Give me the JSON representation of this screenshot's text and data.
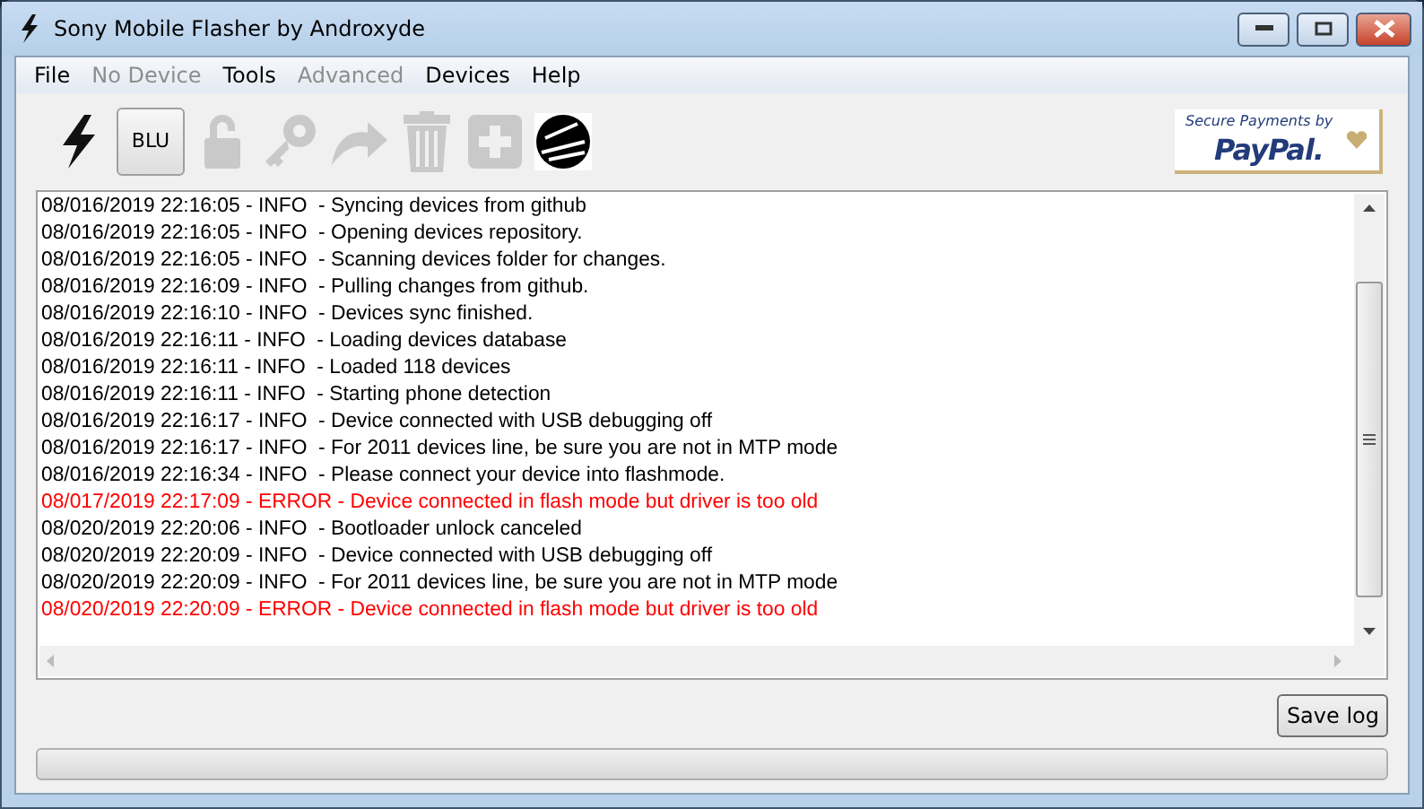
{
  "window": {
    "title": "Sony Mobile Flasher by Androxyde"
  },
  "menu": [
    {
      "label": "File",
      "disabled": false
    },
    {
      "label": "No Device",
      "disabled": true
    },
    {
      "label": "Tools",
      "disabled": false
    },
    {
      "label": "Advanced",
      "disabled": true
    },
    {
      "label": "Devices",
      "disabled": false
    },
    {
      "label": "Help",
      "disabled": false
    }
  ],
  "toolbar": [
    {
      "kind": "flash",
      "disabled": false
    },
    {
      "kind": "text",
      "label": "BLU",
      "disabled": false
    },
    {
      "kind": "unlock",
      "disabled": true
    },
    {
      "kind": "key",
      "disabled": true
    },
    {
      "kind": "redo",
      "disabled": true
    },
    {
      "kind": "trash",
      "disabled": true
    },
    {
      "kind": "plus",
      "disabled": true
    },
    {
      "kind": "logo",
      "disabled": false
    }
  ],
  "paypal": {
    "line_1": "Secure Payments by",
    "line_2": "PayPal."
  },
  "log": [
    {
      "kind": "info",
      "text": "08/016/2019 22:16:05 - INFO  - Syncing devices from github"
    },
    {
      "kind": "info",
      "text": "08/016/2019 22:16:05 - INFO  - Opening devices repository."
    },
    {
      "kind": "info",
      "text": "08/016/2019 22:16:05 - INFO  - Scanning devices folder for changes."
    },
    {
      "kind": "info",
      "text": "08/016/2019 22:16:09 - INFO  - Pulling changes from github."
    },
    {
      "kind": "info",
      "text": "08/016/2019 22:16:10 - INFO  - Devices sync finished."
    },
    {
      "kind": "info",
      "text": "08/016/2019 22:16:11 - INFO  - Loading devices database"
    },
    {
      "kind": "info",
      "text": "08/016/2019 22:16:11 - INFO  - Loaded 118 devices"
    },
    {
      "kind": "info",
      "text": "08/016/2019 22:16:11 - INFO  - Starting phone detection"
    },
    {
      "kind": "info",
      "text": "08/016/2019 22:16:17 - INFO  - Device connected with USB debugging off"
    },
    {
      "kind": "info",
      "text": "08/016/2019 22:16:17 - INFO  - For 2011 devices line, be sure you are not in MTP mode"
    },
    {
      "kind": "info",
      "text": "08/016/2019 22:16:34 - INFO  - Please connect your device into flashmode."
    },
    {
      "kind": "error",
      "text": "08/017/2019 22:17:09 - ERROR - Device connected in flash mode but driver is too old"
    },
    {
      "kind": "info",
      "text": "08/020/2019 22:20:06 - INFO  - Bootloader unlock canceled"
    },
    {
      "kind": "info",
      "text": "08/020/2019 22:20:09 - INFO  - Device connected with USB debugging off"
    },
    {
      "kind": "info",
      "text": "08/020/2019 22:20:09 - INFO  - For 2011 devices line, be sure you are not in MTP mode"
    },
    {
      "kind": "error",
      "text": "08/020/2019 22:20:09 - ERROR - Device connected in flash mode but driver is too old"
    }
  ],
  "save_button": "Save log",
  "progress": {
    "level": 0
  }
}
